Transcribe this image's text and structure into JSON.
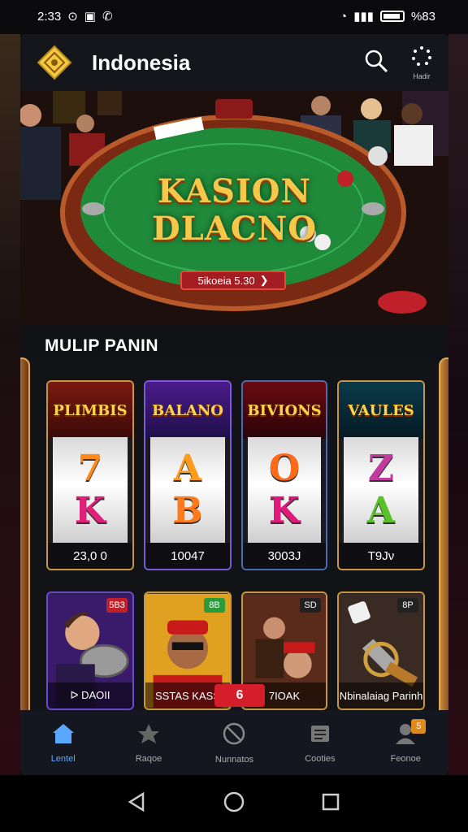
{
  "status_bar": {
    "time": "2:33",
    "battery_text": "%83"
  },
  "header": {
    "title": "Indonesia",
    "menu_label": "Hadir"
  },
  "hero": {
    "title_line1": "KASION",
    "title_line2": "DLACNO",
    "pill_text": "5ikoeia 5.30",
    "pill_arrow": "❯"
  },
  "section": {
    "title": "MULIP PANIN"
  },
  "slots": [
    {
      "name": "PLIMBIS",
      "symbols": [
        "7",
        "K"
      ],
      "value": "23,0 0",
      "color": "#c8963e"
    },
    {
      "name": "BALANO",
      "symbols": [
        "A",
        "B"
      ],
      "value": "10047",
      "color": "#7a5ad8"
    },
    {
      "name": "BIVIONS",
      "symbols": [
        "O",
        "K"
      ],
      "value": "3003J",
      "color": "#4a6bb0"
    },
    {
      "name": "VAULES",
      "symbols": [
        "Z",
        "A"
      ],
      "value": "T9Jν",
      "color": "#c8963e"
    }
  ],
  "games": [
    {
      "label": "ᐅ DAOII",
      "badge": "5B3"
    },
    {
      "label": "SSTAS KASS",
      "badge": "8B"
    },
    {
      "label": "7IOAK",
      "badge": "SD"
    },
    {
      "label": "Nbinalaiag Parinh",
      "badge": "8P"
    }
  ],
  "hot_badge": "6",
  "bottom_nav": [
    {
      "label": "Lentel",
      "icon": "home-icon",
      "active": true
    },
    {
      "label": "Raqoe",
      "icon": "star-icon",
      "active": false
    },
    {
      "label": "Nunnatos",
      "icon": "ban-icon",
      "active": false
    },
    {
      "label": "Cooties",
      "icon": "news-icon",
      "active": false
    },
    {
      "label": "Feonoe",
      "icon": "user-icon",
      "active": false,
      "badge": "5"
    }
  ],
  "colors": {
    "accent": "#f6c84a",
    "background": "#111216",
    "active_nav": "#5aa8ff",
    "hot": "#d61e2a"
  }
}
